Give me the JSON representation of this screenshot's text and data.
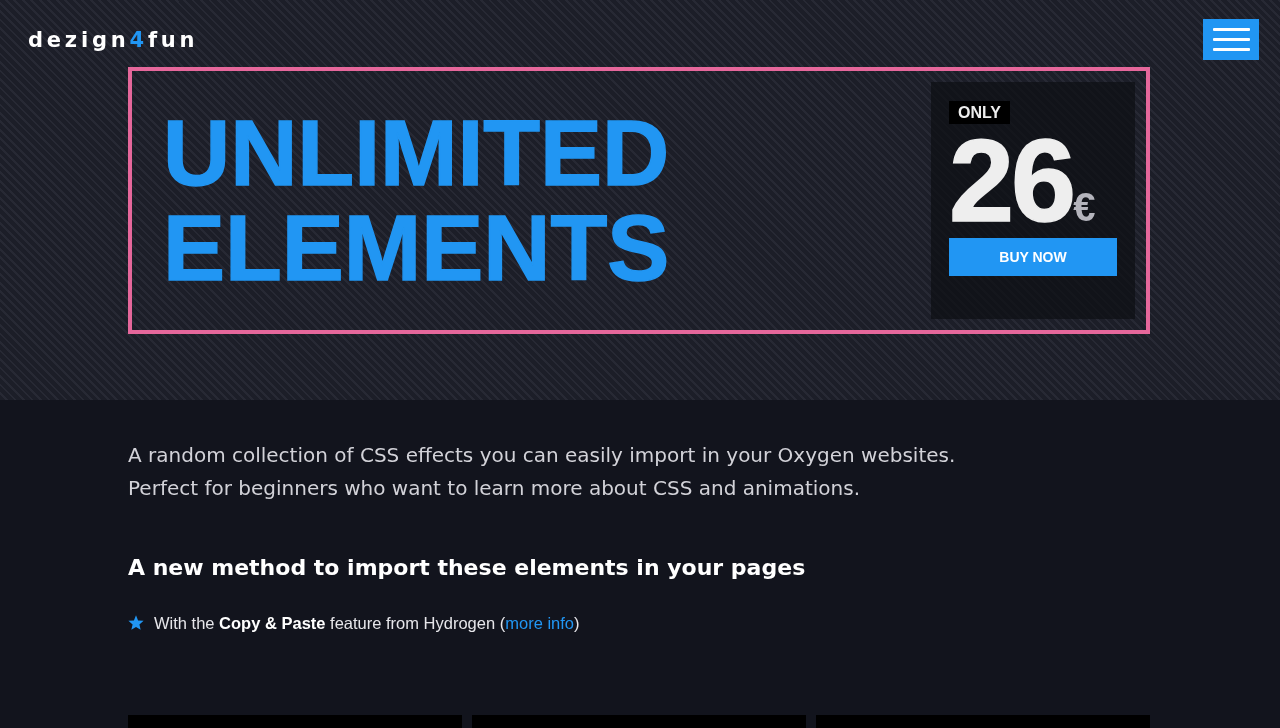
{
  "header": {
    "logo": {
      "before": "dezign",
      "accent": "4",
      "after": "fun"
    }
  },
  "hero": {
    "title_lines": [
      "UNLIMITED",
      "ELEMENTS"
    ],
    "price": {
      "tag": "ONLY",
      "amount": "26",
      "currency": "€",
      "button": "BUY NOW"
    }
  },
  "intro": {
    "lines": [
      "A random collection of CSS effects you can easily import in your Oxygen websites.",
      "Perfect for beginners who want to learn more about CSS and animations."
    ]
  },
  "method": {
    "heading": "A new method to import these elements in your pages",
    "features": [
      {
        "text": "With the **Copy & Paste** feature from Hydrogen (",
        "link": "more info",
        "after": ")"
      }
    ]
  }
}
